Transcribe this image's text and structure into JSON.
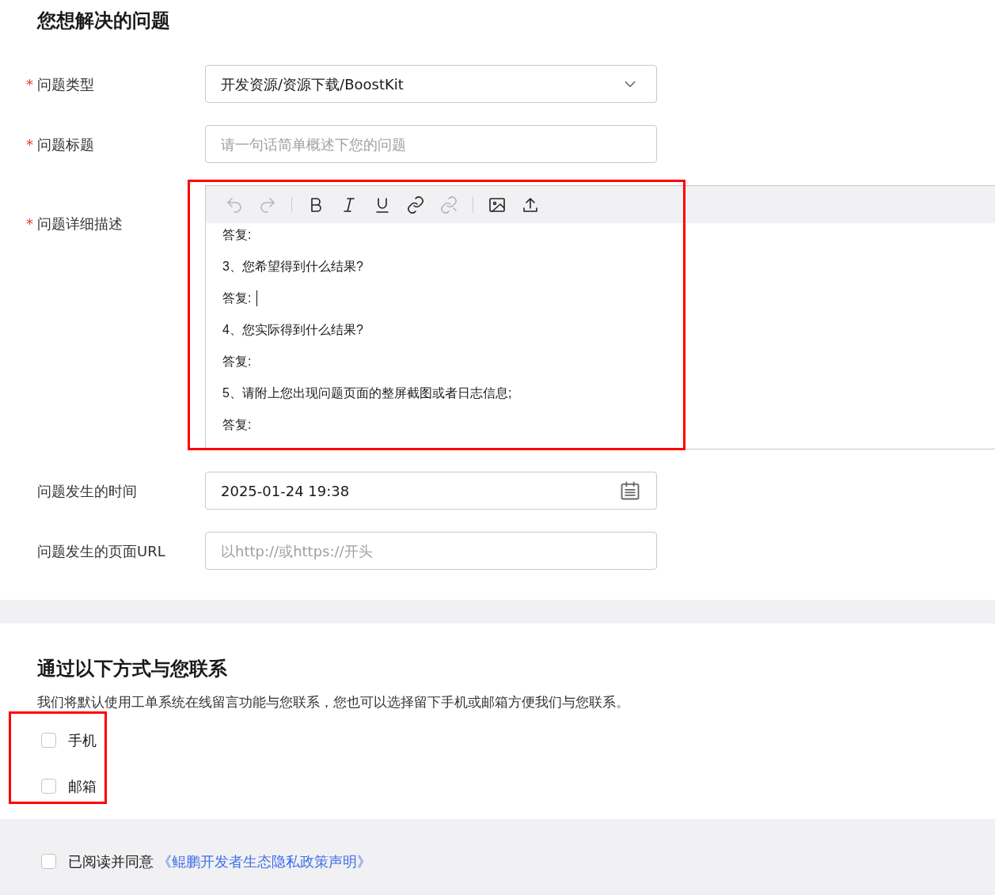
{
  "problem_section": {
    "title": "您想解决的问题",
    "fields": [
      {
        "kind": "select",
        "required_mark": "*",
        "label": "问题类型",
        "value": "开发资源/资源下载/BoostKit"
      },
      {
        "kind": "text",
        "required_mark": "*",
        "label": "问题标题",
        "placeholder": "请一句话简单概述下您的问题"
      },
      {
        "kind": "editor",
        "required_mark": "*",
        "label": "问题详细描述",
        "highlighted": true,
        "lines": [
          {
            "text": "答复:",
            "cursor": false
          },
          {
            "text": "3、您希望得到什么结果?",
            "cursor": false
          },
          {
            "text": "答复: ",
            "cursor": true
          },
          {
            "text": "4、您实际得到什么结果?",
            "cursor": false
          },
          {
            "text": "答复:",
            "cursor": false
          },
          {
            "text": "5、请附上您出现问题页面的整屏截图或者日志信息;",
            "cursor": false
          },
          {
            "text": "答复:",
            "cursor": false
          }
        ]
      },
      {
        "kind": "date",
        "label": "问题发生的时间",
        "value": "2025-01-24 19:38"
      },
      {
        "kind": "text",
        "label": "问题发生的页面URL",
        "placeholder": "以http://或https://开头"
      }
    ]
  },
  "contact_section": {
    "title": "通过以下方式与您联系",
    "description": "我们将默认使用工单系统在线留言功能与您联系，您也可以选择留下手机或邮箱方便我们与您联系。",
    "highlighted": true,
    "options": [
      {
        "label": "手机",
        "checked": false
      },
      {
        "label": "邮箱",
        "checked": false
      }
    ]
  },
  "agreement": {
    "checked": false,
    "text": "已阅读并同意",
    "link": "《鲲鹏开发者生态隐私政策声明》"
  }
}
